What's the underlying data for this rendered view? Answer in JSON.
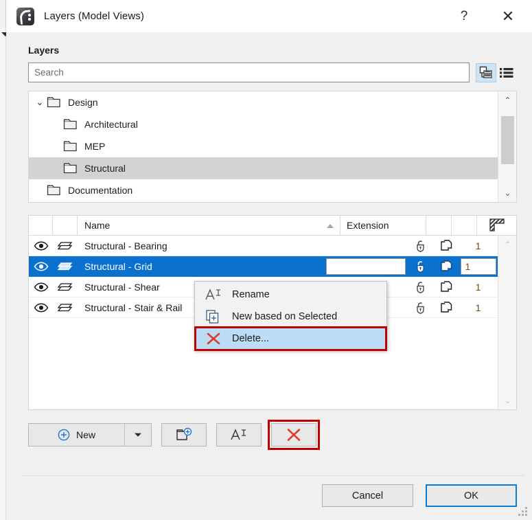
{
  "window": {
    "title": "Layers (Model Views)",
    "app_icon": "archicad-logo-icon",
    "help_label": "?",
    "close_label": "✕"
  },
  "panel": {
    "section_label": "Layers"
  },
  "search": {
    "placeholder": "Search",
    "value": "",
    "tree_view_icon": "tree-view-icon",
    "list_view_icon": "list-view-icon",
    "active_view": "tree"
  },
  "tree": {
    "items": [
      {
        "label": "Design",
        "indent": 0,
        "expanded": true,
        "selected": false,
        "chevron": "⌄"
      },
      {
        "label": "Architectural",
        "indent": 1,
        "expanded": false,
        "selected": false,
        "chevron": ""
      },
      {
        "label": "MEP",
        "indent": 1,
        "expanded": false,
        "selected": false,
        "chevron": ""
      },
      {
        "label": "Structural",
        "indent": 1,
        "expanded": false,
        "selected": true,
        "chevron": ""
      },
      {
        "label": "Documentation",
        "indent": 0,
        "expanded": false,
        "selected": false,
        "chevron": ""
      }
    ],
    "scroll_up": "⌃",
    "scroll_down": "⌄"
  },
  "table": {
    "columns": {
      "eye": "",
      "layer": "",
      "name": "Name",
      "extension": "Extension",
      "lock": "",
      "solid": "",
      "pen": "hatch-pattern-icon"
    },
    "sort": {
      "column": "Name",
      "direction": "ascending"
    },
    "rows": [
      {
        "name": "Structural - Bearing",
        "extension": "",
        "pen": "1",
        "selected": false,
        "visible": true,
        "locked": false,
        "editing": false
      },
      {
        "name": "Structural - Grid",
        "extension": "",
        "pen": "1",
        "selected": true,
        "visible": true,
        "locked": false,
        "editing": true
      },
      {
        "name": "Structural - Shear",
        "extension": "",
        "pen": "1",
        "selected": false,
        "visible": true,
        "locked": false,
        "editing": false
      },
      {
        "name": "Structural - Stair & Rail",
        "extension": "",
        "pen": "1",
        "selected": false,
        "visible": true,
        "locked": false,
        "editing": false
      }
    ],
    "scroll_up": "⌃",
    "scroll_down": "⌄"
  },
  "context_menu": {
    "items": [
      {
        "label": "Rename",
        "icon": "rename-icon",
        "highlighted": false
      },
      {
        "label": "New based on Selected",
        "icon": "duplicate-icon",
        "highlighted": false
      },
      {
        "label": "Delete...",
        "icon": "delete-x-icon",
        "highlighted": true
      }
    ]
  },
  "toolbar": {
    "new_label": "New",
    "new_icon": "plus-circle-icon",
    "new_dropdown_icon": "chevron-down-icon",
    "new_folder_icon": "new-folder-icon",
    "rename_icon": "rename-icon",
    "delete_icon": "delete-x-icon"
  },
  "footer": {
    "cancel_label": "Cancel",
    "ok_label": "OK"
  },
  "colors": {
    "selection_blue": "#0b71cf",
    "menu_highlight": "#bdddf7",
    "annotation_red": "#c00000",
    "delete_x_red": "#e03a2f",
    "accent_blue": "#0a7bd6",
    "tree_selection_gray": "#d3d3d3",
    "dialog_bg": "#f0f0f0"
  }
}
